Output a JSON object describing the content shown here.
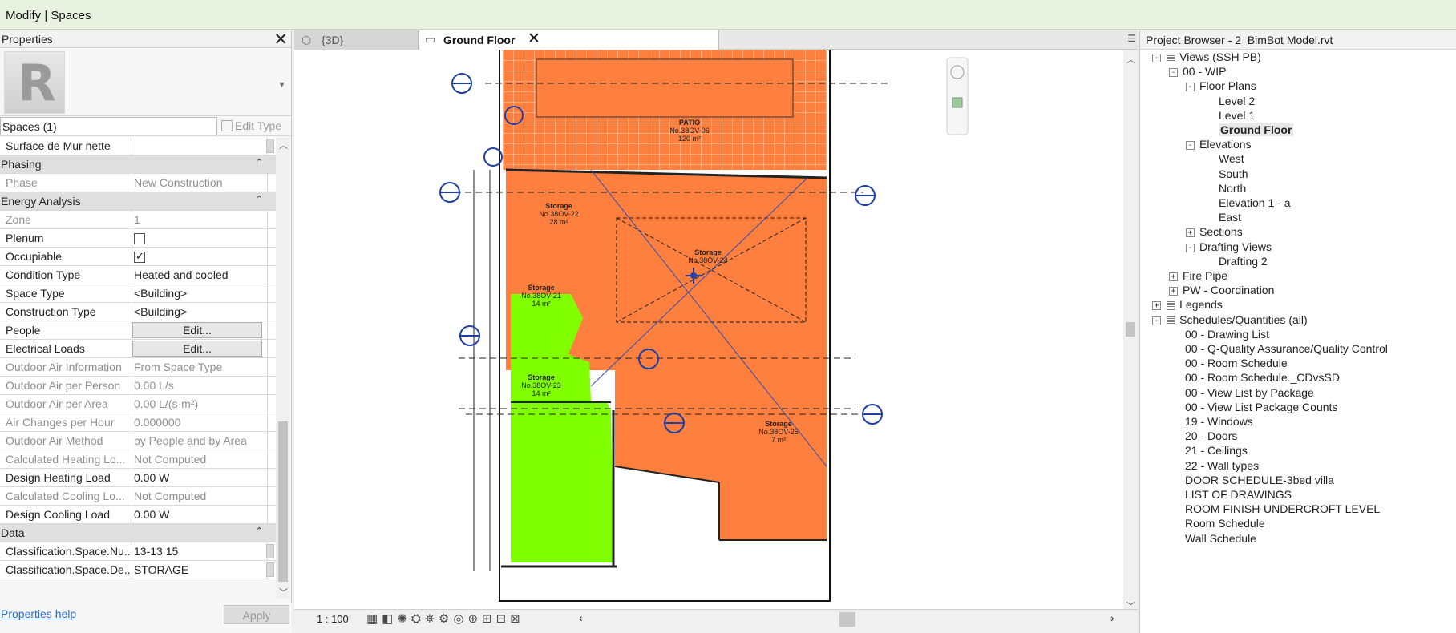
{
  "window": {
    "title": "Modify | Spaces"
  },
  "properties": {
    "header": "Properties",
    "logo_letter": "R",
    "type_selector": "Spaces (1)",
    "edit_type": "Edit Type",
    "rows": [
      {
        "kind": "prop",
        "label": "Surface de Mur nette",
        "value": "",
        "disabled": false
      },
      {
        "kind": "group",
        "label": "Phasing"
      },
      {
        "kind": "prop",
        "label": "Phase",
        "value": "New Construction",
        "disabled": true
      },
      {
        "kind": "group",
        "label": "Energy Analysis"
      },
      {
        "kind": "prop",
        "label": "Zone",
        "value": "1",
        "disabled": true
      },
      {
        "kind": "check",
        "label": "Plenum",
        "checked": false
      },
      {
        "kind": "check",
        "label": "Occupiable",
        "checked": true
      },
      {
        "kind": "prop",
        "label": "Condition Type",
        "value": "Heated and cooled",
        "disabled": false
      },
      {
        "kind": "prop",
        "label": "Space Type",
        "value": "<Building>",
        "disabled": false
      },
      {
        "kind": "prop",
        "label": "Construction Type",
        "value": "<Building>",
        "disabled": false
      },
      {
        "kind": "button",
        "label": "People",
        "value": "Edit..."
      },
      {
        "kind": "button",
        "label": "Electrical Loads",
        "value": "Edit..."
      },
      {
        "kind": "prop",
        "label": "Outdoor Air Information",
        "value": "From Space Type",
        "disabled": true
      },
      {
        "kind": "prop",
        "label": "Outdoor Air per Person",
        "value": "0.00 L/s",
        "disabled": true
      },
      {
        "kind": "prop",
        "label": "Outdoor Air per Area",
        "value": "0.00 L/(s·m²)",
        "disabled": true
      },
      {
        "kind": "prop",
        "label": "Air Changes per Hour",
        "value": "0.000000",
        "disabled": true
      },
      {
        "kind": "prop",
        "label": "Outdoor Air Method",
        "value": "by People and by Area",
        "disabled": true
      },
      {
        "kind": "prop",
        "label": "Calculated Heating Lo...",
        "value": "Not Computed",
        "disabled": true
      },
      {
        "kind": "prop",
        "label": "Design Heating Load",
        "value": "0.00 W",
        "disabled": false
      },
      {
        "kind": "prop",
        "label": "Calculated Cooling Lo...",
        "value": "Not Computed",
        "disabled": true
      },
      {
        "kind": "prop",
        "label": "Design Cooling Load",
        "value": "0.00 W",
        "disabled": false
      },
      {
        "kind": "group",
        "label": "Data"
      },
      {
        "kind": "prop",
        "label": "Classification.Space.Nu...",
        "value": "13-13 15",
        "disabled": false,
        "tail": true
      },
      {
        "kind": "prop",
        "label": "Classification.Space.De...",
        "value": "STORAGE",
        "disabled": false,
        "tail": true
      }
    ],
    "help_link": "Properties help",
    "apply": "Apply"
  },
  "tabs": {
    "inactive": "{3D}",
    "active": "Ground Floor"
  },
  "view_control": {
    "scale": "1 : 100"
  },
  "drawing": {
    "rooms": [
      {
        "name": "PATIO",
        "number": "No.38OV-06",
        "area": "120 m²"
      },
      {
        "name": "Storage",
        "number": "No.38OV-22",
        "area": "28 m²"
      },
      {
        "name": "Storage",
        "number": "No.38OV-24",
        "area": ""
      },
      {
        "name": "Storage",
        "number": "No.38OV-21",
        "area": "14 m²"
      },
      {
        "name": "Storage",
        "number": "No.38OV-23",
        "area": "14 m²"
      },
      {
        "name": "Storage",
        "number": "No.38OV-25",
        "area": "7 m²"
      }
    ],
    "colors": {
      "orange": "#ff7f3f",
      "green": "#80ff00",
      "marker": "#1f3fa6"
    }
  },
  "project_browser": {
    "header": "Project Browser - 2_BimBot Model.rvt",
    "nodes": [
      {
        "label": "Views (SSH PB)",
        "level": 0,
        "toggle": "-",
        "icon": true
      },
      {
        "label": "00 - WIP",
        "level": 1,
        "toggle": "-"
      },
      {
        "label": "Floor Plans",
        "level": 2,
        "toggle": "-"
      },
      {
        "label": "Level 2",
        "level": 3
      },
      {
        "label": "Level 1",
        "level": 3
      },
      {
        "label": "Ground Floor",
        "level": 3,
        "selected": true
      },
      {
        "label": "Elevations",
        "level": 2,
        "toggle": "-"
      },
      {
        "label": "West",
        "level": 3
      },
      {
        "label": "South",
        "level": 3
      },
      {
        "label": "North",
        "level": 3
      },
      {
        "label": "Elevation 1 - a",
        "level": 3
      },
      {
        "label": "East",
        "level": 3
      },
      {
        "label": "Sections",
        "level": 2,
        "toggle": "+"
      },
      {
        "label": "Drafting Views",
        "level": 2,
        "toggle": "-"
      },
      {
        "label": "Drafting 2",
        "level": 3
      },
      {
        "label": "Fire Pipe",
        "level": 1,
        "toggle": "+"
      },
      {
        "label": "PW - Coordination",
        "level": 1,
        "toggle": "+"
      },
      {
        "label": "Legends",
        "level": 0,
        "toggle": "+",
        "icon": true
      },
      {
        "label": "Schedules/Quantities (all)",
        "level": 0,
        "toggle": "-",
        "icon": true
      },
      {
        "label": "00 - Drawing List",
        "level": 1
      },
      {
        "label": "00 - Q-Quality Assurance/Quality Control",
        "level": 1
      },
      {
        "label": "00 - Room Schedule",
        "level": 1
      },
      {
        "label": "00 - Room Schedule _CDvsSD",
        "level": 1
      },
      {
        "label": "00 - View List by Package",
        "level": 1
      },
      {
        "label": "00 - View List Package Counts",
        "level": 1
      },
      {
        "label": "19 - Windows",
        "level": 1
      },
      {
        "label": "20 - Doors",
        "level": 1
      },
      {
        "label": "21 - Ceilings",
        "level": 1
      },
      {
        "label": "22 - Wall types",
        "level": 1
      },
      {
        "label": "DOOR SCHEDULE-3bed villa",
        "level": 1
      },
      {
        "label": "LIST OF DRAWINGS",
        "level": 1
      },
      {
        "label": "ROOM FINISH-UNDERCROFT LEVEL",
        "level": 1
      },
      {
        "label": "Room Schedule",
        "level": 1
      },
      {
        "label": "Wall Schedule",
        "level": 1
      }
    ]
  }
}
